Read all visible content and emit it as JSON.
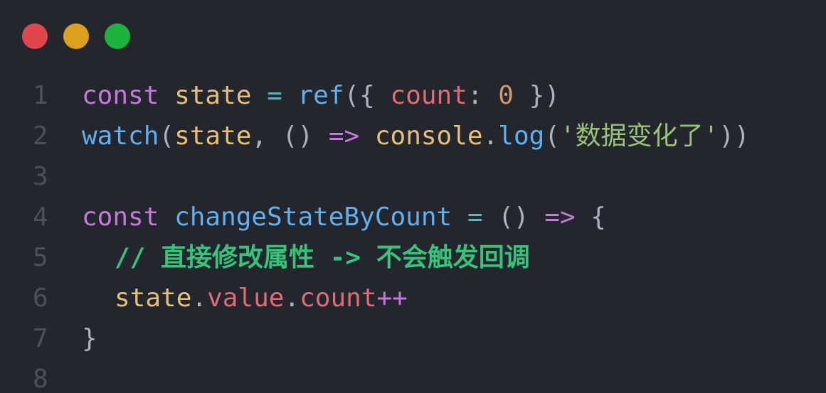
{
  "window": {
    "controls": [
      {
        "name": "close",
        "color": "#e0474c"
      },
      {
        "name": "minimize",
        "color": "#dca01b"
      },
      {
        "name": "maximize",
        "color": "#1db33f"
      }
    ]
  },
  "colors": {
    "keyword": "#c678dd",
    "function": "#61afef",
    "variable": "#e5c07b",
    "property": "#e06c75",
    "number": "#d19a66",
    "string": "#98c379",
    "comment": "#37c47a",
    "operator": "#c678dd",
    "punct": "#abb2bf",
    "cyanop": "#56b6c2"
  },
  "code": {
    "lines": [
      {
        "number": "1",
        "tokens": [
          {
            "text": "const",
            "type": "keyword"
          },
          {
            "text": " ",
            "type": "punct"
          },
          {
            "text": "state",
            "type": "variable"
          },
          {
            "text": " = ",
            "type": "cyanop"
          },
          {
            "text": "ref",
            "type": "function"
          },
          {
            "text": "({ ",
            "type": "punct"
          },
          {
            "text": "count",
            "type": "property"
          },
          {
            "text": ": ",
            "type": "punct"
          },
          {
            "text": "0",
            "type": "number"
          },
          {
            "text": " })",
            "type": "punct"
          }
        ]
      },
      {
        "number": "2",
        "tokens": [
          {
            "text": "watch",
            "type": "function"
          },
          {
            "text": "(",
            "type": "punct"
          },
          {
            "text": "state",
            "type": "variable"
          },
          {
            "text": ", () ",
            "type": "punct"
          },
          {
            "text": "=>",
            "type": "operator"
          },
          {
            "text": " ",
            "type": "punct"
          },
          {
            "text": "console",
            "type": "variable"
          },
          {
            "text": ".",
            "type": "punct"
          },
          {
            "text": "log",
            "type": "function"
          },
          {
            "text": "(",
            "type": "punct"
          },
          {
            "text": "'数据变化了'",
            "type": "string"
          },
          {
            "text": "))",
            "type": "punct"
          }
        ]
      },
      {
        "number": "3",
        "tokens": []
      },
      {
        "number": "4",
        "tokens": [
          {
            "text": "const",
            "type": "keyword"
          },
          {
            "text": " ",
            "type": "punct"
          },
          {
            "text": "changeStateByCount",
            "type": "function"
          },
          {
            "text": " = ",
            "type": "cyanop"
          },
          {
            "text": "() ",
            "type": "punct"
          },
          {
            "text": "=>",
            "type": "operator"
          },
          {
            "text": " {",
            "type": "punct"
          }
        ]
      },
      {
        "number": "5",
        "indent": true,
        "tokens": [
          {
            "text": "// 直接修改属性 -> 不会触发回调",
            "type": "comment"
          }
        ]
      },
      {
        "number": "6",
        "indent": true,
        "tokens": [
          {
            "text": "state",
            "type": "variable"
          },
          {
            "text": ".",
            "type": "punct"
          },
          {
            "text": "value",
            "type": "property"
          },
          {
            "text": ".",
            "type": "punct"
          },
          {
            "text": "count",
            "type": "property"
          },
          {
            "text": "++",
            "type": "operator"
          }
        ]
      },
      {
        "number": "7",
        "tokens": [
          {
            "text": "}",
            "type": "punct"
          }
        ]
      },
      {
        "number": "8",
        "tokens": []
      }
    ]
  }
}
